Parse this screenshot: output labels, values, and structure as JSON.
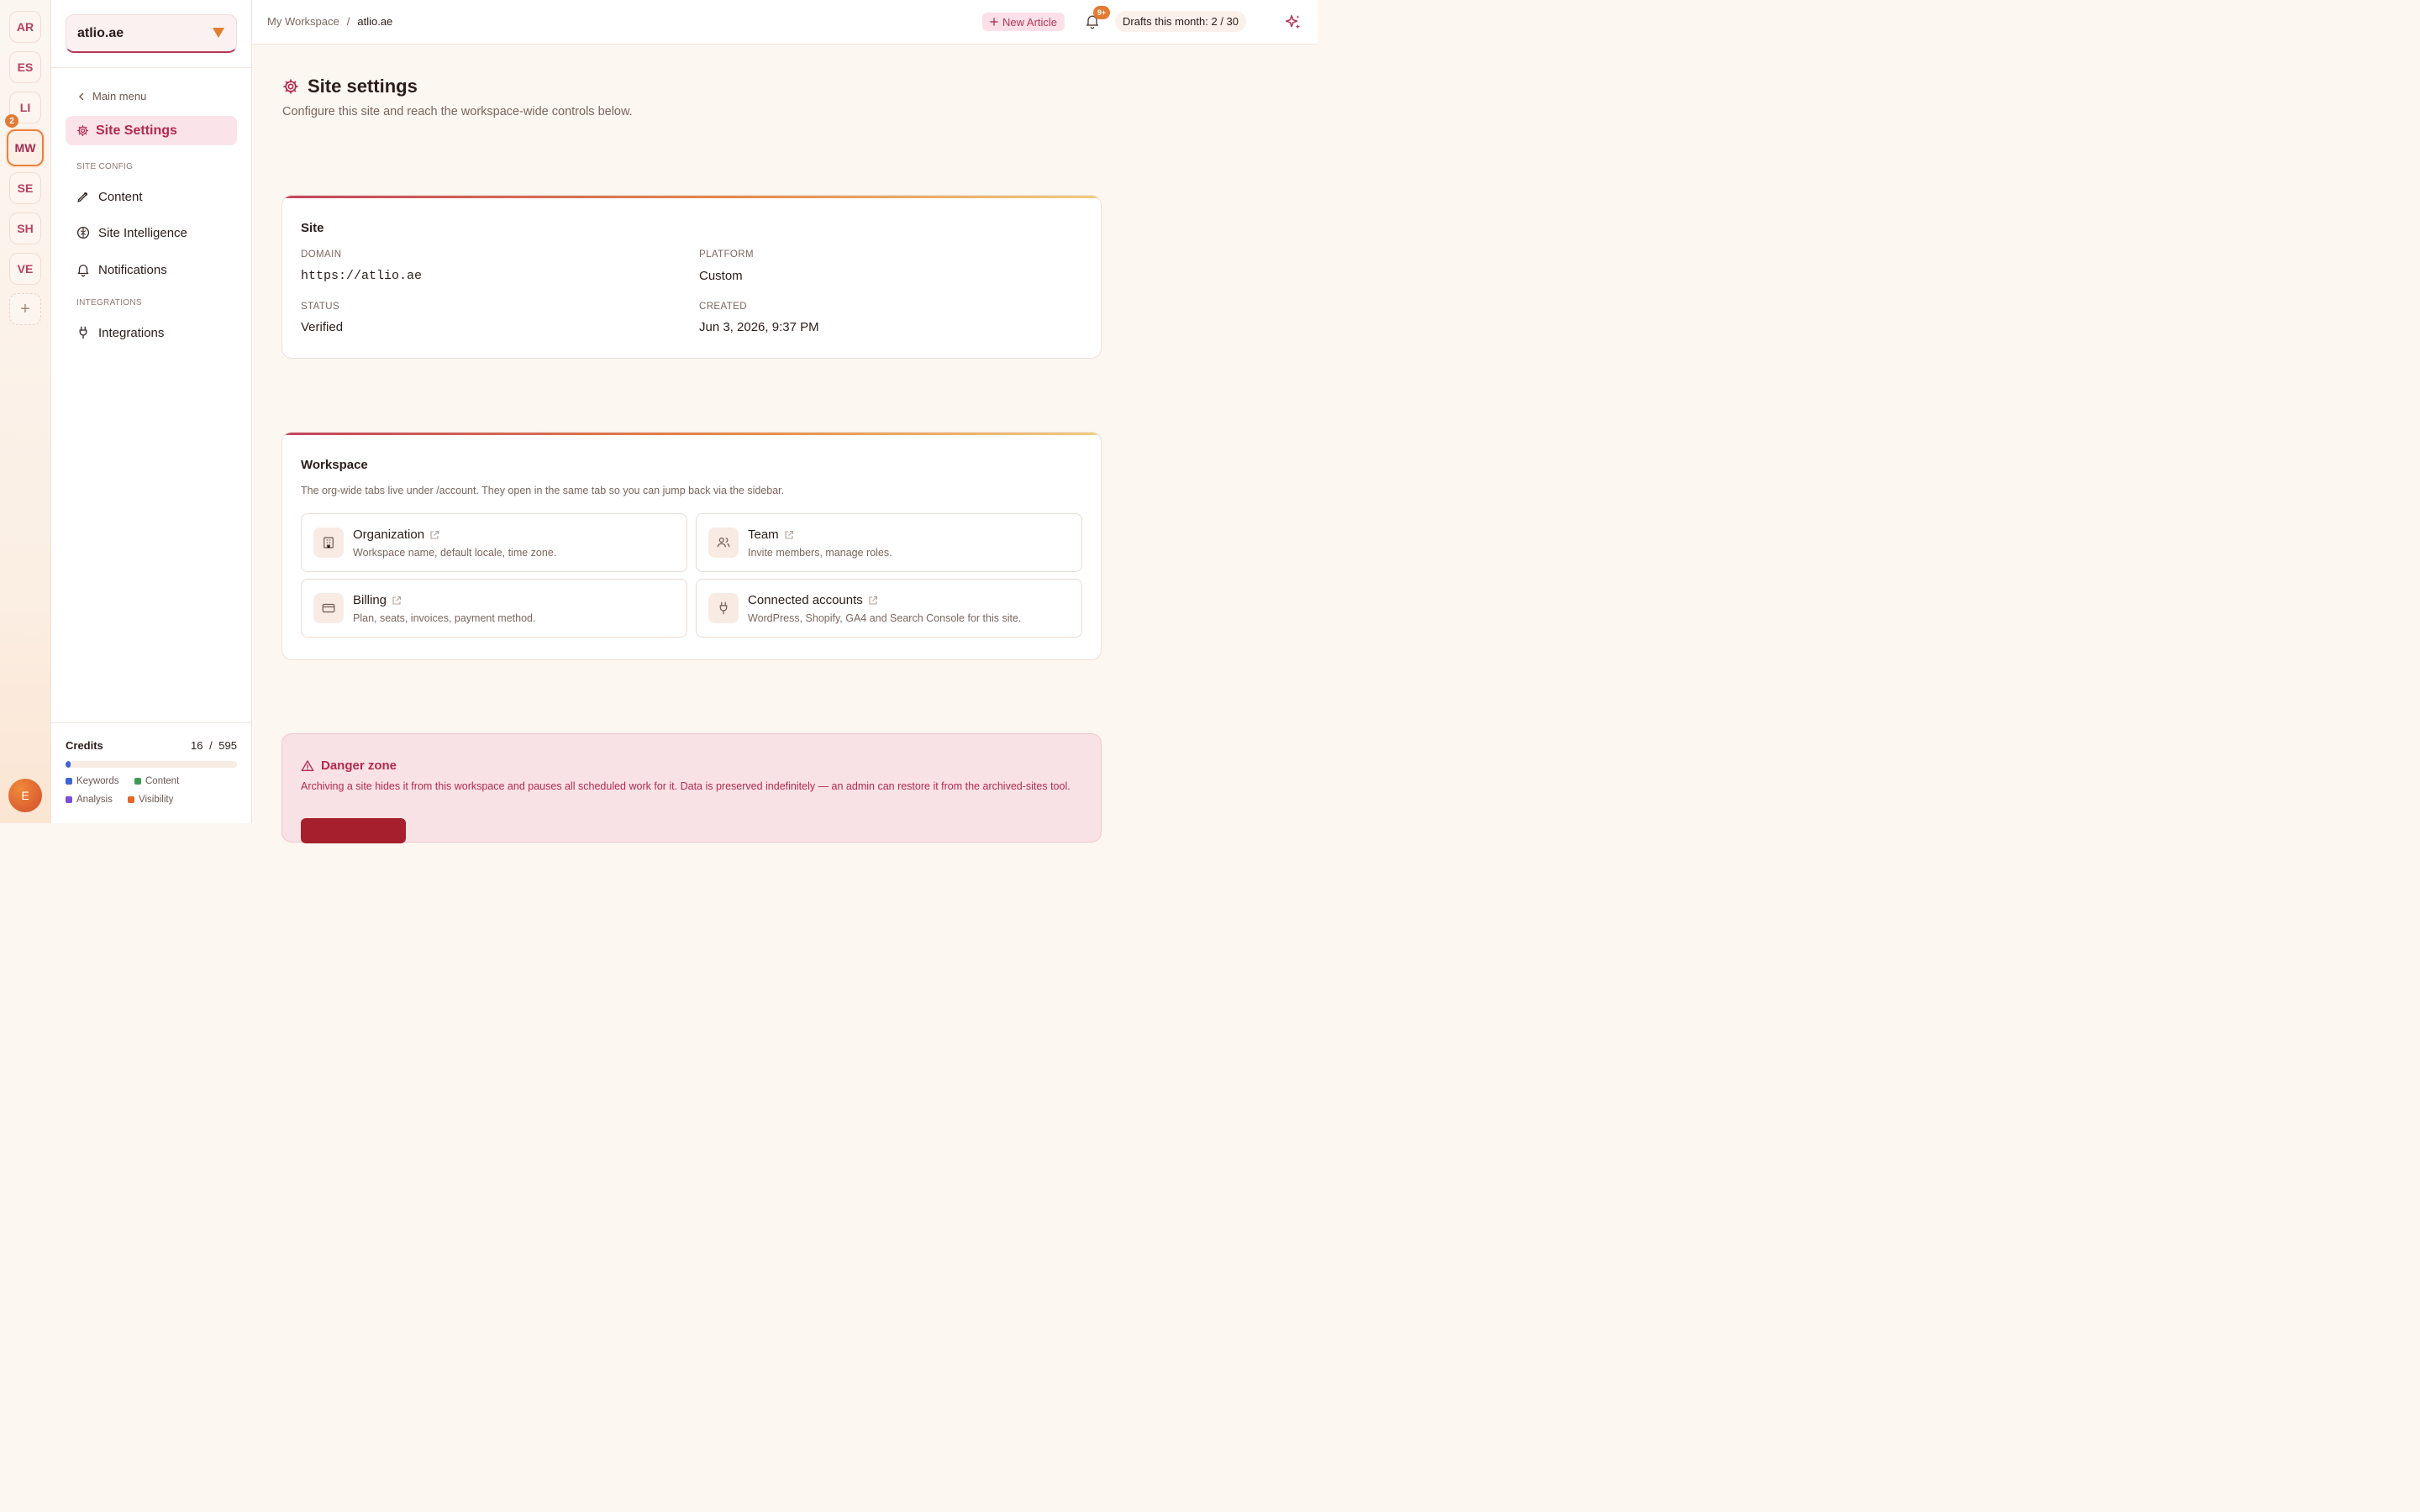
{
  "rail": {
    "workspaces": [
      "AR",
      "ES",
      "LI",
      "MW",
      "SE",
      "SH",
      "VE"
    ],
    "active": "MW",
    "badge_count": "2",
    "add_label": "+",
    "user_initial": "E"
  },
  "sidebar": {
    "site_selector": "atlio.ae",
    "back_label": "Main menu",
    "active_item": "Site Settings",
    "section_site_config": "SITE CONFIG",
    "items": [
      "Content",
      "Site Intelligence",
      "Notifications"
    ],
    "section_integrations": "INTEGRATIONS",
    "integrations_item": "Integrations",
    "credits": {
      "title": "Credits",
      "used": "16",
      "total": "595",
      "used_fraction": 0.027,
      "legend": [
        {
          "label": "Keywords",
          "color": "#3a64d8"
        },
        {
          "label": "Content",
          "color": "#3f9a57"
        },
        {
          "label": "Analysis",
          "color": "#7a4fd8"
        },
        {
          "label": "Visibility",
          "color": "#e0682c"
        }
      ]
    }
  },
  "topbar": {
    "breadcrumb": [
      "My Workspace",
      "atlio.ae"
    ],
    "separator": "/",
    "new_article": "New Article",
    "notifications_badge": "9+",
    "drafts": "Drafts this month: 2 / 30"
  },
  "page": {
    "title": "Site settings",
    "subtitle": "Configure this site and reach the workspace-wide controls below."
  },
  "site_card": {
    "title": "Site",
    "fields": {
      "domain_label": "DOMAIN",
      "domain": "https://atlio.ae",
      "platform_label": "PLATFORM",
      "platform": "Custom",
      "status_label": "STATUS",
      "status": "Verified",
      "created_label": "CREATED",
      "created": "Jun 3, 2026, 9:37 PM"
    }
  },
  "workspace_card": {
    "title": "Workspace",
    "description": "The org-wide tabs live under /account. They open in the same tab so you can jump back via the sidebar.",
    "tiles": [
      {
        "title": "Organization",
        "desc": "Workspace name, default locale, time zone.",
        "icon": "building-icon"
      },
      {
        "title": "Team",
        "desc": "Invite members, manage roles.",
        "icon": "users-icon"
      },
      {
        "title": "Billing",
        "desc": "Plan, seats, invoices, payment method.",
        "icon": "credit-card-icon"
      },
      {
        "title": "Connected accounts",
        "desc": "WordPress, Shopify, GA4 and Search Console for this site.",
        "icon": "plug-icon"
      }
    ]
  },
  "danger": {
    "title": "Danger zone",
    "description": "Archiving a site hides it from this workspace and pauses all scheduled work for it. Data is preserved indefinitely — an admin can restore it from the archived-sites tool."
  },
  "colors": {
    "accent": "#b3294f",
    "orange": "#e27b34",
    "blue": "#3a64d8"
  }
}
